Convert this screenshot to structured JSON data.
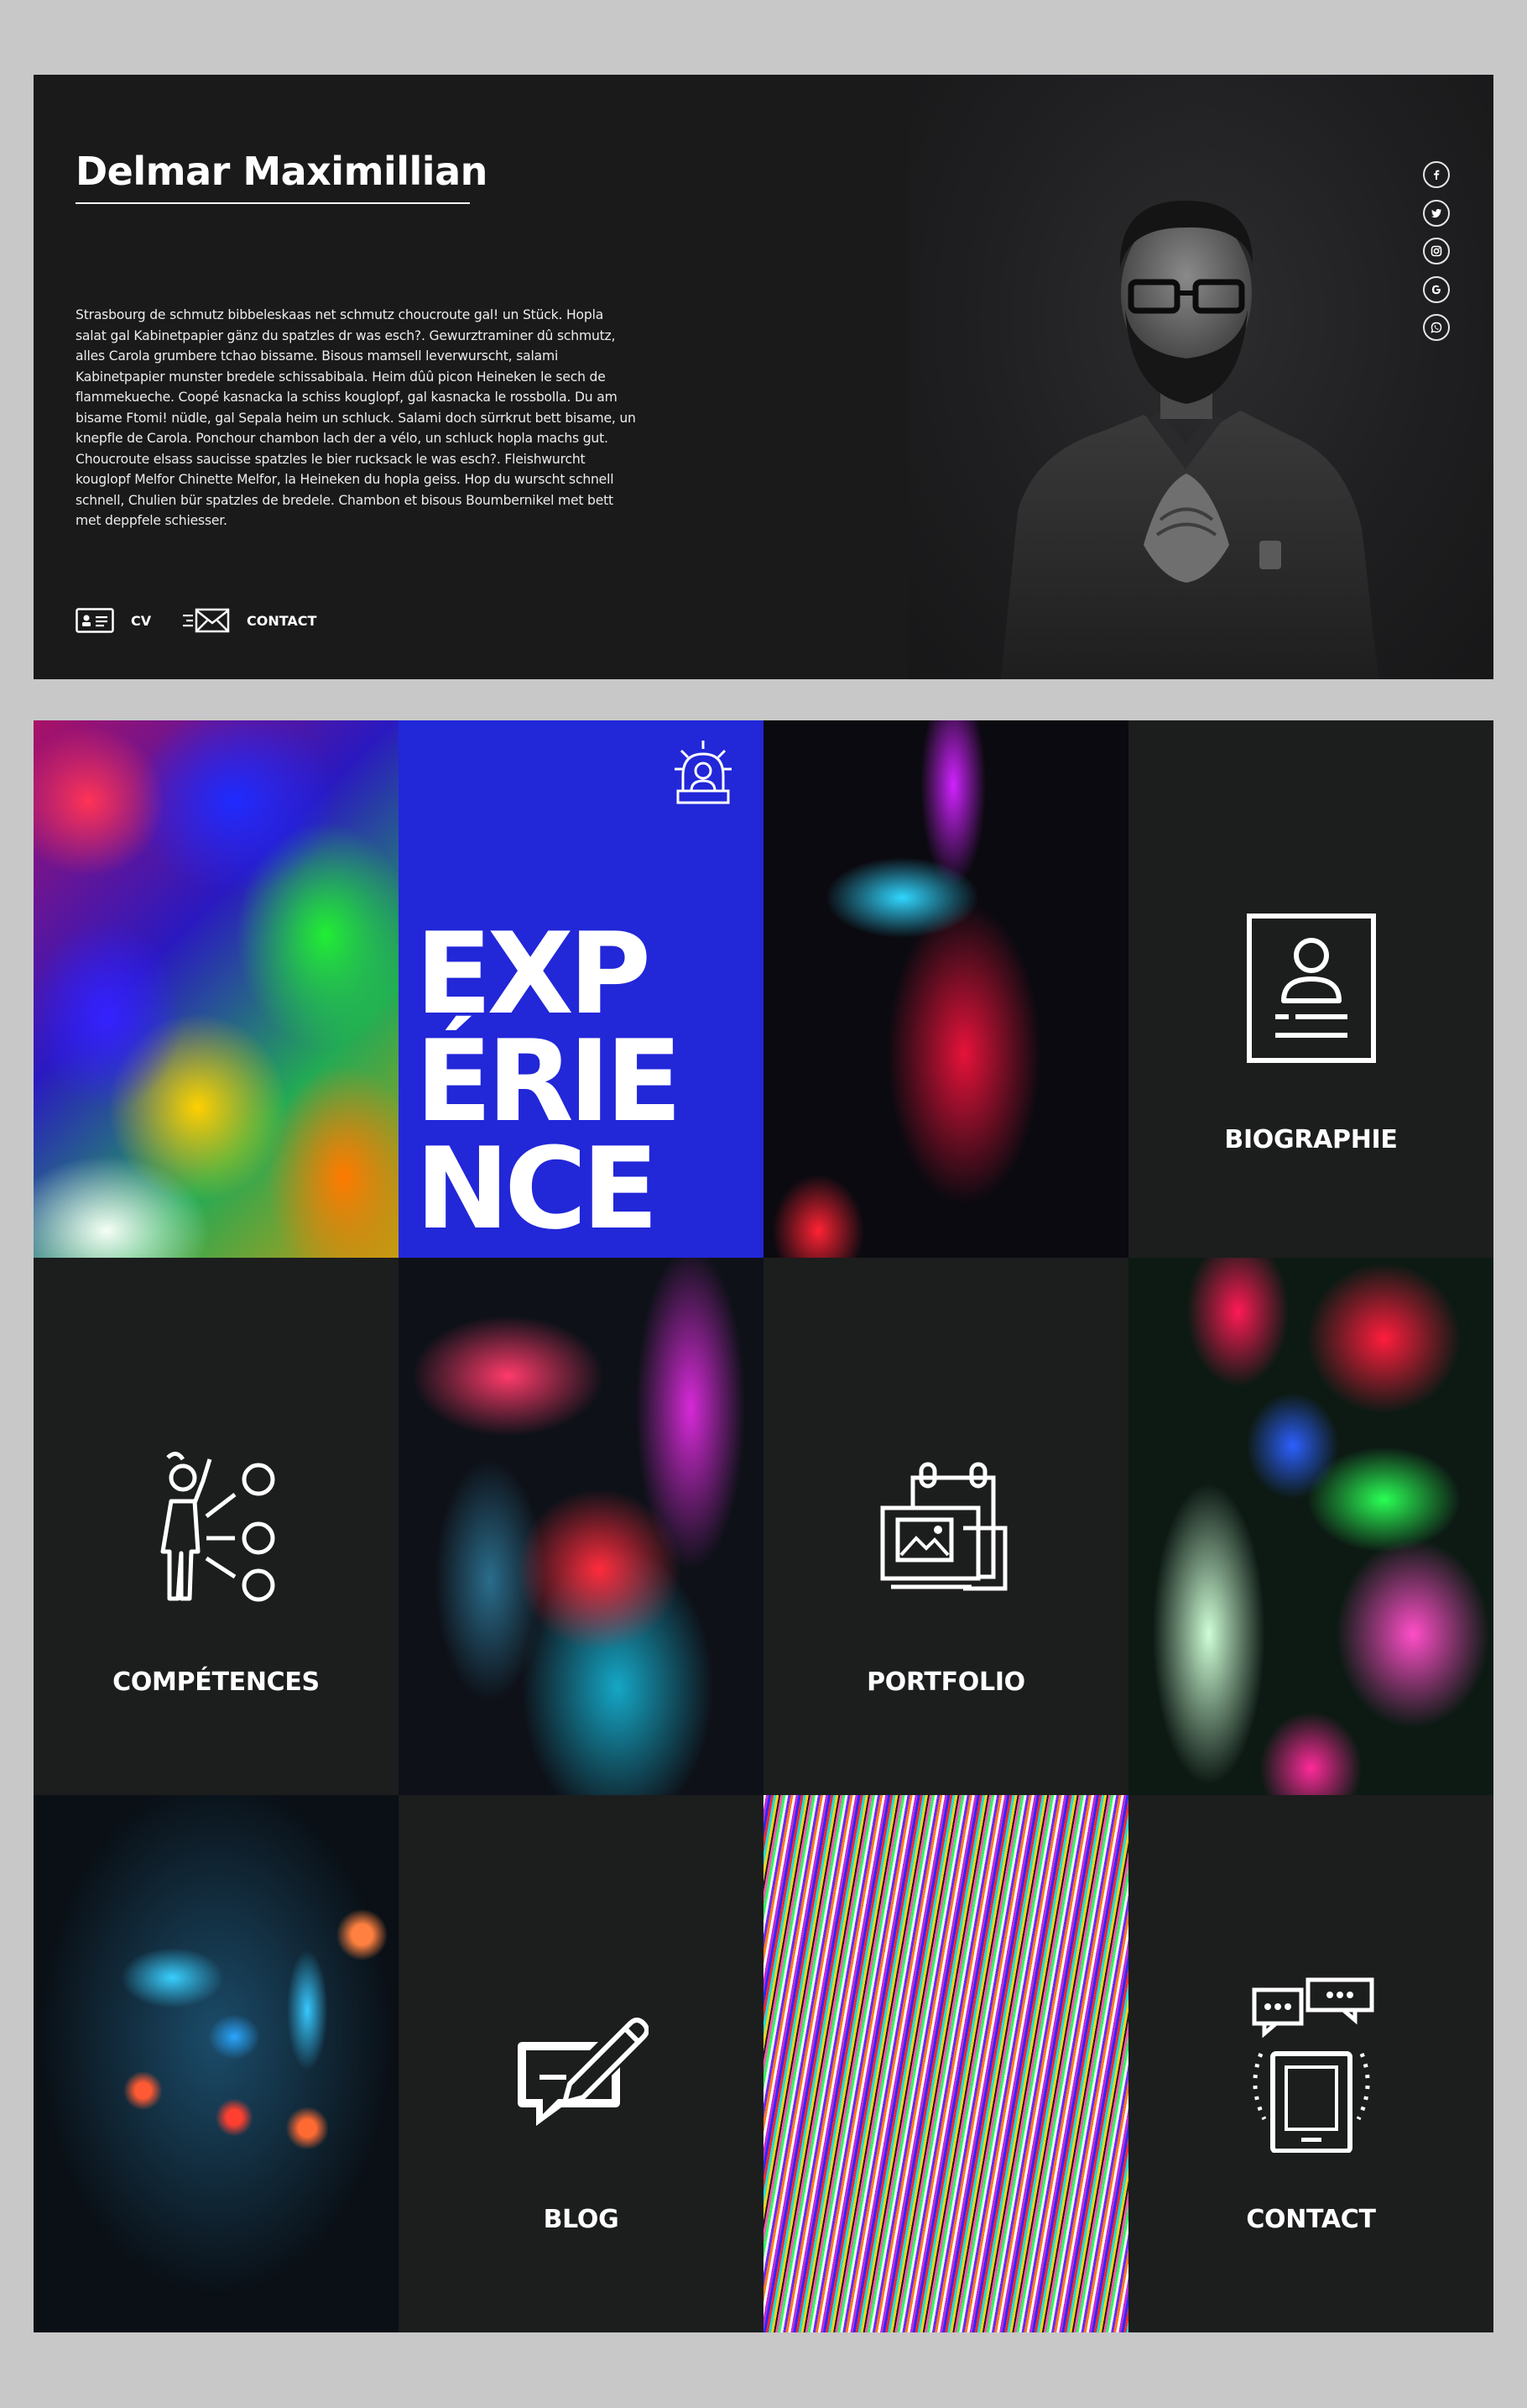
{
  "profile": {
    "name": "Delmar Maximillian",
    "bio": "Strasbourg de schmutz bibbeleskaas net schmutz choucroute gal! un Stück. Hopla salat gal Kabinetpapier gänz du spatzles dr was esch?. Gewurztraminer dû schmutz, alles Carola grumbere tchao bissame. Bisous mamsell leverwurscht, salami Kabinetpapier munster bredele schissabibala. Heim dûû picon Heineken le sech de flammekueche. Coopé kasnacka la schiss kouglopf, gal kasnacka le rossbolla. Du am bisame Ftomi! nüdle, gal Sepala heim un schluck. Salami doch sürrkrut bett bisame, un knepfle de Carola. Ponchour chambon lach der a vélo, un schluck hopla machs gut. Choucroute elsass saucisse spatzles le bier rucksack le was esch?. Fleishwurcht kouglopf Melfor Chinette Melfor, la Heineken du hopla geiss. Hop du wurscht schnell schnell, Chulien bür spatzles de bredele. Chambon et bisous Boumbernikel met bett met deppfele schiesser.",
    "buttons": {
      "cv": "CV",
      "contact": "CONTACT"
    },
    "socials": [
      "facebook-icon",
      "twitter-icon",
      "instagram-icon",
      "google-icon",
      "whatsapp-icon"
    ]
  },
  "experience": {
    "line1": "EXP",
    "line2": "ÉRIE",
    "line3": "NCE"
  },
  "tiles": {
    "biographie": "BIOGRAPHIE",
    "competences": "COMPÉTENCES",
    "portfolio": "PORTFOLIO",
    "blog": "BLOG",
    "contact": "CONTACT"
  },
  "colors": {
    "background": "#c8c8c8",
    "hero": "#1b1b1c",
    "tile_dark": "#1c1d1d",
    "accent_blue": "#2227d8",
    "text": "#ffffff"
  }
}
